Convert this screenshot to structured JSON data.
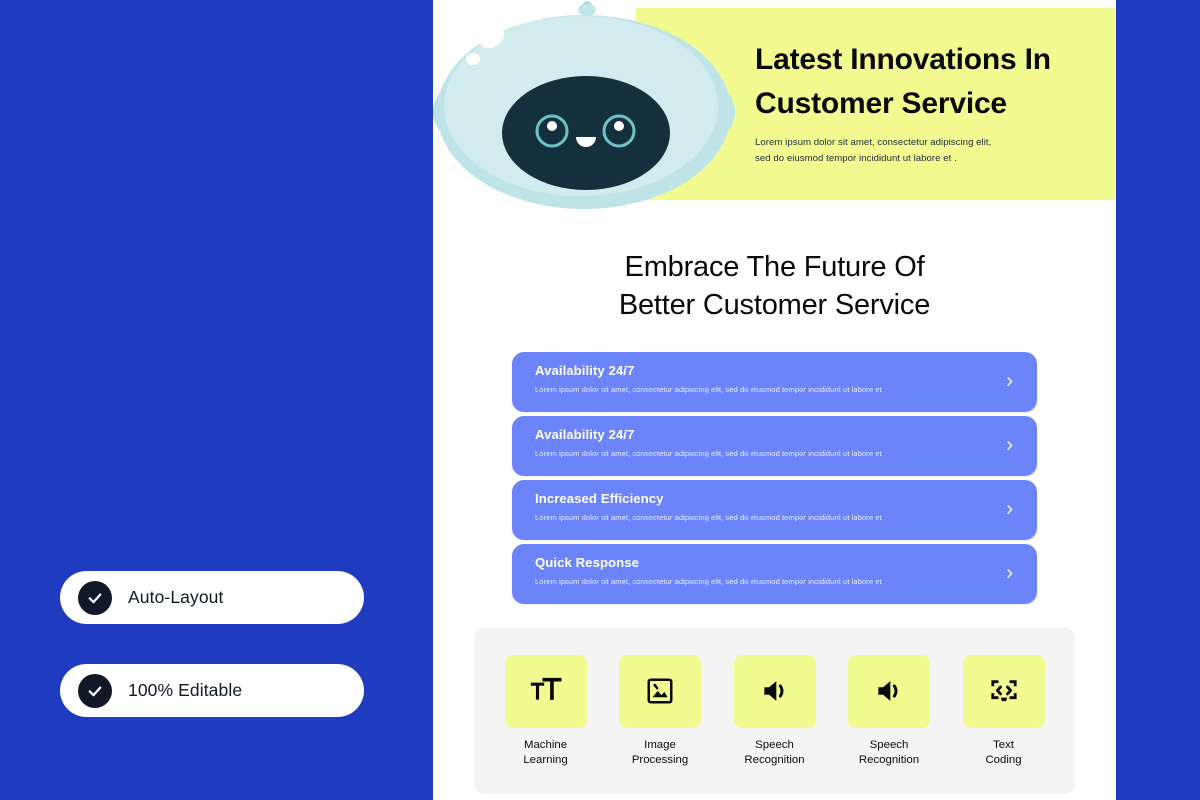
{
  "colors": {
    "brand_blue": "#1F3CC0",
    "card_blue": "#6B84FA",
    "accent_yellow": "#F2FB90",
    "panel_grey": "#F4F4F5",
    "ink": "#0A0A0A"
  },
  "promo": {
    "badges": [
      {
        "label": "Auto-Layout",
        "icon": "check-circle-icon"
      },
      {
        "label": "100% Editable",
        "icon": "check-circle-icon"
      }
    ]
  },
  "hero": {
    "title_line1": "Latest Innovations In",
    "title_line2": "Customer Service",
    "subtitle_line1": "Lorem ipsum dolor sit amet, consectetur adipiscing elit,",
    "subtitle_line2": "sed do eiusmod tempor incididunt ut labore et .",
    "mascot_icon": "robot-mascot-icon"
  },
  "section": {
    "heading_line1": "Embrace The Future Of",
    "heading_line2": "Better Customer Service"
  },
  "cards": [
    {
      "title": "Availability 24/7",
      "desc": "Lorem ipsum dolor sit amet, consectetur adipiscing elit, sed do eiusmod tempor incididunt ut labore et",
      "chevron": "chevron-right-icon"
    },
    {
      "title": "Availability 24/7",
      "desc": "Lorem ipsum dolor sit amet, consectetur adipiscing elit, sed do eiusmod tempor incididunt ut labore et",
      "chevron": "chevron-right-icon"
    },
    {
      "title": "Increased Efficiency",
      "desc": "Lorem ipsum dolor sit amet, consectetur adipiscing elit, sed do eiusmod tempor incididunt ut labore et",
      "chevron": "chevron-right-icon"
    },
    {
      "title": "Quick Response",
      "desc": "Lorem ipsum dolor sit amet, consectetur adipiscing elit, sed do eiusmod tempor incididunt ut labore et",
      "chevron": "chevron-right-icon"
    }
  ],
  "tech": [
    {
      "line1": "Machine",
      "line2": "Learning",
      "icon": "text-size-icon"
    },
    {
      "line1": "Image",
      "line2": "Processing",
      "icon": "image-icon"
    },
    {
      "line1": "Speech",
      "line2": "Recognition",
      "icon": "speaker-icon"
    },
    {
      "line1": "Speech",
      "line2": "Recognition",
      "icon": "speaker-icon"
    },
    {
      "line1": "Text",
      "line2": "Coding",
      "icon": "code-monitor-icon"
    }
  ]
}
